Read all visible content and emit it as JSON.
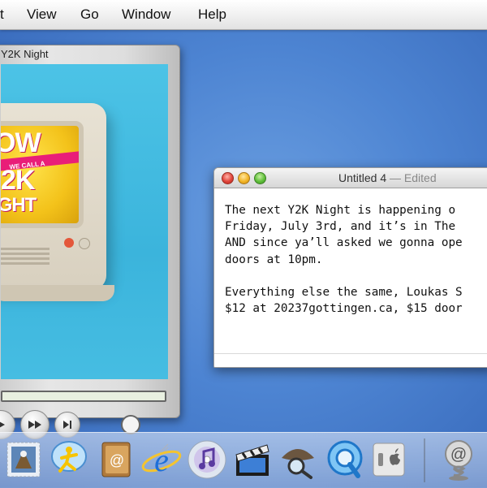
{
  "menubar": {
    "items": [
      "t",
      "View",
      "Go",
      "Window",
      "Help"
    ]
  },
  "quicktime": {
    "title": "Y2K Night",
    "tv_text": {
      "line1": "OW",
      "band": "WE CALL A",
      "line2": "2K",
      "line3": "IGHT"
    }
  },
  "textedit": {
    "title": "Untitled 4",
    "status": "— Edited",
    "lines": [
      "The next Y2K Night is happening o",
      "Friday, July 3rd, and it’s in The ",
      "AND since ya’ll asked we gonna ope",
      "doors at 10pm.",
      "",
      "Everything else the same, Loukas S",
      "$12 at 20237gottingen.ca, $15 door"
    ]
  },
  "dock": {
    "items": [
      {
        "name": "mail",
        "icon": "eagle-stamp-icon"
      },
      {
        "name": "ichat",
        "icon": "aim-running-man-icon"
      },
      {
        "name": "address-book",
        "icon": "address-book-icon"
      },
      {
        "name": "internet-explorer",
        "icon": "ie-e-icon"
      },
      {
        "name": "itunes",
        "icon": "cd-music-note-icon"
      },
      {
        "name": "imovie",
        "icon": "clapperboard-icon"
      },
      {
        "name": "sherlock",
        "icon": "detective-hat-magnifier-icon"
      },
      {
        "name": "quicktime",
        "icon": "quicktime-q-icon"
      },
      {
        "name": "system-preferences",
        "icon": "light-switch-apple-icon"
      },
      {
        "name": "internet-connect",
        "icon": "at-sign-spring-icon"
      }
    ]
  },
  "colors": {
    "desktop": "#4d84d2",
    "video_bg": "#3bb4dc",
    "tv_screen": "#f3c21a",
    "tv_band": "#e91e78"
  }
}
